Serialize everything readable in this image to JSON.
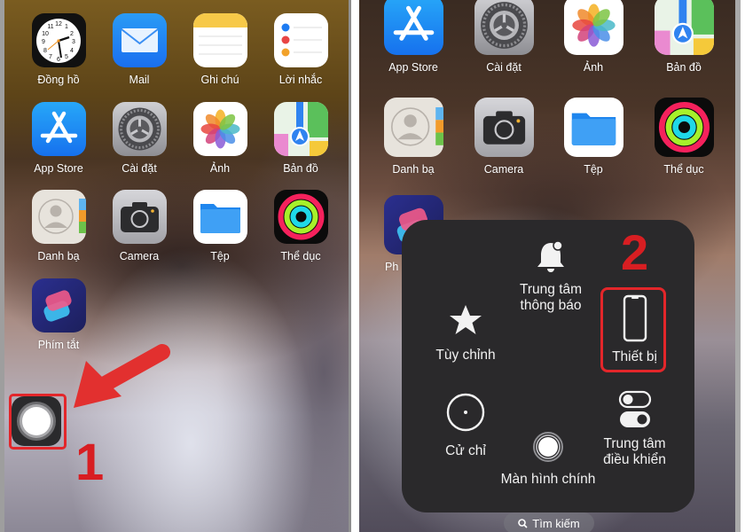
{
  "left_screen": {
    "apps": [
      {
        "id": "clock",
        "label": "Đồng hồ"
      },
      {
        "id": "mail",
        "label": "Mail"
      },
      {
        "id": "notes",
        "label": "Ghi chú"
      },
      {
        "id": "reminders",
        "label": "Lời nhắc"
      },
      {
        "id": "app-store",
        "label": "App Store"
      },
      {
        "id": "settings",
        "label": "Cài đặt"
      },
      {
        "id": "photos",
        "label": "Ảnh"
      },
      {
        "id": "maps",
        "label": "Bản đồ"
      },
      {
        "id": "contacts",
        "label": "Danh bạ"
      },
      {
        "id": "camera",
        "label": "Camera"
      },
      {
        "id": "files",
        "label": "Tệp"
      },
      {
        "id": "fitness",
        "label": "Thể dục"
      },
      {
        "id": "shortcuts",
        "label": "Phím tắt"
      }
    ],
    "annotation_number": "1"
  },
  "right_screen": {
    "apps": [
      {
        "id": "app-store",
        "label": "App Store"
      },
      {
        "id": "settings",
        "label": "Cài đặt"
      },
      {
        "id": "photos",
        "label": "Ảnh"
      },
      {
        "id": "maps",
        "label": "Bản đồ"
      },
      {
        "id": "contacts",
        "label": "Danh bạ"
      },
      {
        "id": "camera",
        "label": "Camera"
      },
      {
        "id": "files",
        "label": "Tệp"
      },
      {
        "id": "fitness",
        "label": "Thể dục"
      },
      {
        "id": "shortcuts",
        "label": "Ph"
      }
    ],
    "assistive_menu": {
      "notification_center": "Trung tâm\nthông báo",
      "customize": "Tùy chỉnh",
      "device": "Thiết bị",
      "gestures": "Cử chỉ",
      "control_center": "Trung tâm\nđiều khiển",
      "home": "Màn hình chính"
    },
    "annotation_number": "2",
    "search_label": "Tìm kiếm"
  },
  "colors": {
    "annotation_red": "#e3262a",
    "menu_background": "#2a292b"
  }
}
